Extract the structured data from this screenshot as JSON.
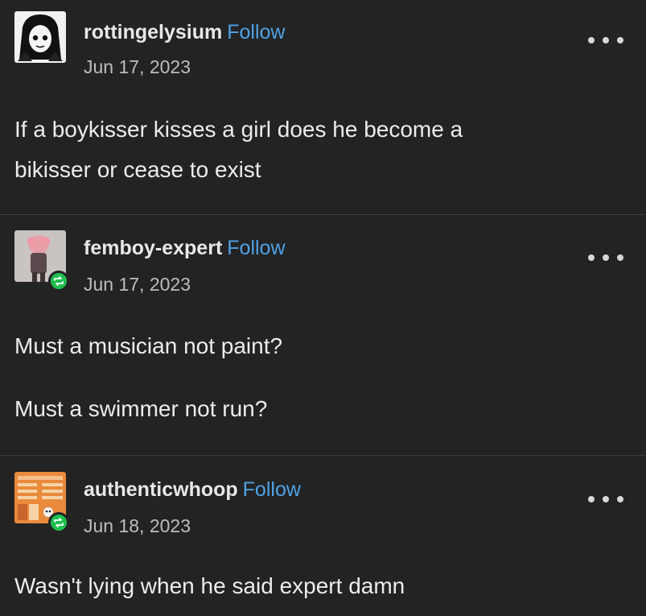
{
  "posts": [
    {
      "username": "rottingelysium",
      "follow_label": "Follow",
      "date": "Jun 17, 2023",
      "avatar_icon": "goth-portrait-avatar",
      "reblogged": false,
      "body": [
        "If a boykisser kisses a girl does he become a",
        "bikisser or cease to exist"
      ]
    },
    {
      "username": "femboy-expert",
      "follow_label": "Follow",
      "date": "Jun 17, 2023",
      "avatar_icon": "pink-hair-figure-avatar",
      "reblogged": true,
      "body": [
        "Must a musician not paint?",
        "Must a swimmer not run?"
      ]
    },
    {
      "username": "authenticwhoop",
      "follow_label": "Follow",
      "date": "Jun 18, 2023",
      "avatar_icon": "orange-card-avatar",
      "reblogged": true,
      "body": [
        "Wasn't lying when he said expert damn"
      ]
    }
  ],
  "colors": {
    "background": "#232323",
    "follow": "#4ea2e6",
    "reblog_badge": "#1fbf4f",
    "divider": "#3a3a3a"
  },
  "icons": {
    "menu": "more-options-icon",
    "reblog": "reblog-icon"
  }
}
